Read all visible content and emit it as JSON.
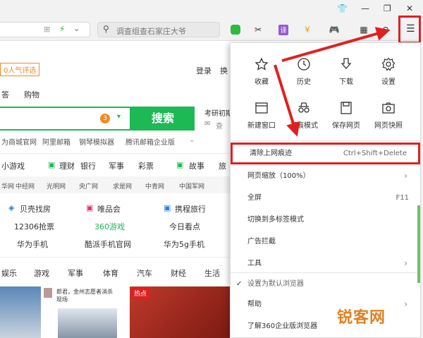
{
  "toolbar": {
    "search_placeholder": "调查组查石家庄大爷",
    "translate_label": "译"
  },
  "page": {
    "popular_badge": "0人气评选",
    "login": "登录",
    "switch": "换",
    "tabs": [
      "答",
      "购物"
    ],
    "search_count": "3",
    "search_button": "搜索",
    "side_note1": "考研初期",
    "side_note2": "查",
    "quick_links": [
      "为商城官网",
      "阿里邮箱",
      "钢琴模拟器",
      "腾讯邮箱企业版"
    ],
    "categories": [
      "小游戏",
      "理财",
      "银行",
      "军事",
      "彩票",
      "故事",
      "旅"
    ],
    "sites": [
      "华网",
      "中经网",
      "光明网",
      "央广网",
      "求是网",
      "中青网",
      "中国军网"
    ],
    "grid": [
      [
        "贝壳找房",
        "唯品会",
        "携程旅行"
      ],
      [
        "12306抢票",
        "360游戏",
        "今日看点"
      ],
      [
        "华为手机",
        "酷派手机官网",
        "华为5g手机"
      ]
    ],
    "news_tabs": [
      "娱乐",
      "游戏",
      "军事",
      "体育",
      "汽车",
      "财经",
      "生活"
    ],
    "news_snippet": "郎君，金州志愿者消杀现场",
    "hot_label": "热点"
  },
  "menu": {
    "icons": [
      {
        "label": "收藏",
        "icon": "star-icon"
      },
      {
        "label": "历史",
        "icon": "clock-icon"
      },
      {
        "label": "下载",
        "icon": "download-icon"
      },
      {
        "label": "设置",
        "icon": "gear-icon"
      },
      {
        "label": "新建窗口",
        "icon": "window-icon"
      },
      {
        "label": "无痕模式",
        "icon": "incognito-icon"
      },
      {
        "label": "保存网页",
        "icon": "save-icon"
      },
      {
        "label": "网页快照",
        "icon": "camera-icon"
      }
    ],
    "clear_history": "清除上网痕迹",
    "clear_shortcut": "Ctrl+Shift+Delete",
    "zoom": "网页缩放（100%）",
    "fullscreen": "全屏",
    "fullscreen_key": "F11",
    "multitab": "切换到多标签模式",
    "adblock": "广告拦截",
    "tools": "工具",
    "default_browser": "设置为默认浏览器",
    "help": "帮助",
    "about": "了解360企业版浏览器"
  },
  "watermark": "锐客网",
  "colors": {
    "accent_green": "#1db954",
    "highlight_red": "#e02020",
    "orange": "#f08a24"
  }
}
